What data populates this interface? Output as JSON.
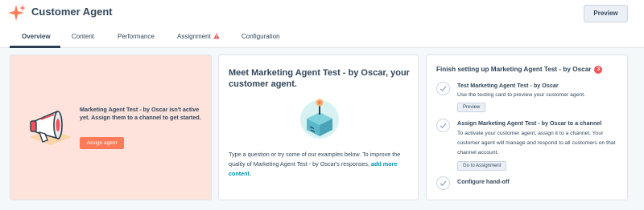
{
  "header": {
    "title": "Customer Agent",
    "preview_label": "Preview",
    "brand_color": "#ff7a59"
  },
  "tabs": [
    {
      "label": "Overview",
      "active": true
    },
    {
      "label": "Content",
      "active": false
    },
    {
      "label": "Performance",
      "active": false
    },
    {
      "label": "Assignment",
      "active": false,
      "icon": "warning-icon"
    },
    {
      "label": "Configuration",
      "active": false
    }
  ],
  "status_card": {
    "message": "Marketing Agent Test - by Oscar isn't active yet. Assign them to a channel to get started.",
    "button_label": "Assign agent",
    "icon": "megaphone-icon"
  },
  "intro_card": {
    "title": "Meet Marketing Agent Test - by Oscar, your customer agent.",
    "icon": "bot-box-icon",
    "body_text": "Type a question or try some of our examples below. To improve the quality of Marketing Agent Test - by Oscar's responses,",
    "link_text": "add more content."
  },
  "setup_card": {
    "title": "Finish setting up Marketing Agent Test - by Oscar",
    "badge_count": "3",
    "steps": [
      {
        "title": "Test Marketing Agent Test - by Oscar",
        "description": "Use the testing card to preview your customer agent.",
        "button_label": "Preview"
      },
      {
        "title": "Assign Marketing Agent Test - by Oscar to a channel",
        "description": "To activate your customer agent, assign it to a channel. Your customer agent will manage and respond to all customers on that channel account.",
        "button_label": "Go to Assignment"
      },
      {
        "title": "Configure hand-off"
      }
    ]
  }
}
